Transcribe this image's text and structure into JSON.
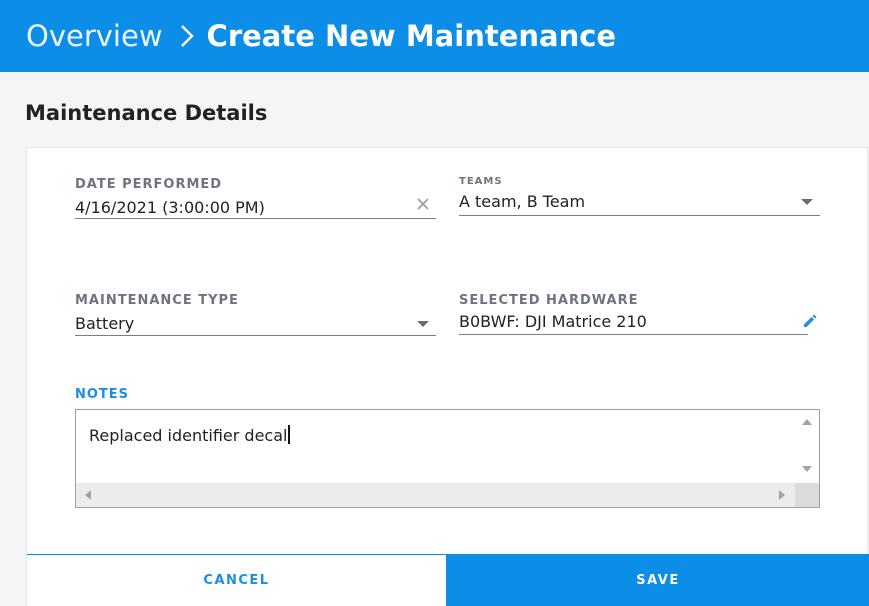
{
  "header": {
    "breadcrumb_link": "Overview",
    "title": "Create New Maintenance",
    "background_color": "#0c8ee8",
    "separator_icon": "chevron-right-icon"
  },
  "section": {
    "title": "Maintenance Details"
  },
  "form": {
    "date_performed": {
      "label": "DATE PERFORMED",
      "value": "4/16/2021 (3:00:00 PM)",
      "clear_icon": "close-icon"
    },
    "teams": {
      "label": "TEAMS",
      "value": "A team, B Team",
      "dropdown_icon": "caret-down-icon"
    },
    "maintenance_type": {
      "label": "MAINTENANCE TYPE",
      "value": "Battery",
      "dropdown_icon": "caret-down-icon"
    },
    "selected_hardware": {
      "label": "SELECTED HARDWARE",
      "value": "B0BWF: DJI Matrice 210",
      "edit_icon": "pencil-icon"
    },
    "notes": {
      "label": "NOTES",
      "value": "Replaced identifier decal"
    }
  },
  "actions": {
    "cancel_label": "CANCEL",
    "save_label": "SAVE"
  }
}
